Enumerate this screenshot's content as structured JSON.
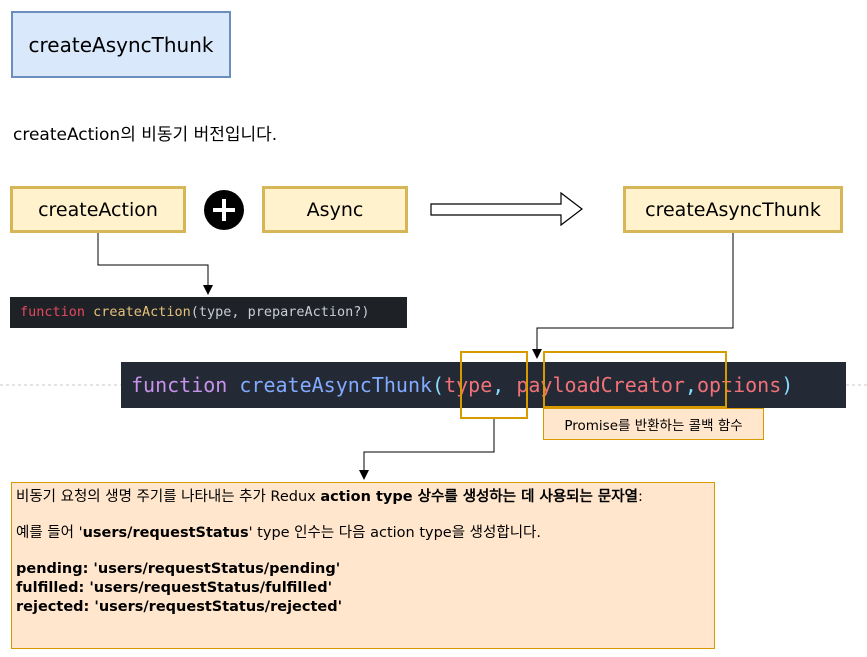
{
  "title": "createAsyncThunk",
  "subtitle": "createAction의 비동기 버전입니다.",
  "boxes": {
    "create_action": "createAction",
    "async": "Async",
    "create_async_thunk": "createAsyncThunk"
  },
  "code1": {
    "keyword": "function",
    "name": "createAction",
    "params": "(type, prepareAction?)"
  },
  "code2": {
    "keyword": "function",
    "name": "createAsyncThunk",
    "paren_open": "(",
    "type_param": "type",
    "comma1": ", ",
    "payload_param": "payloadCreator",
    "comma2": ",",
    "options_param": "options",
    "paren_close": ")"
  },
  "payload_note": "Promise를 반환하는 콜백 함수",
  "description": {
    "line1_prefix": "비동기 요청의 생명 주기를 나타내는 추가 Redux ",
    "line1_bold": "action type 상수를 생성하는 데 사용되는 문자열",
    "line1_suffix": ":",
    "line2_prefix": "예를 들어 '",
    "line2_bold": "users/requestStatus",
    "line2_suffix": "' type 인수는 다음 action type을 생성합니다.",
    "pending": "pending: 'users/requestStatus/pending'",
    "fulfilled": "fulfilled: 'users/requestStatus/fulfilled'",
    "rejected": "rejected: 'users/requestStatus/rejected'"
  },
  "colors": {
    "title_fill": "#dae8fc",
    "title_stroke": "#6c8ebf",
    "yellow_fill": "#fff2cc",
    "yellow_stroke": "#d6b656",
    "orange_fill": "#ffe6cc",
    "orange_stroke": "#d79b00",
    "code_bg": "#242a35"
  }
}
